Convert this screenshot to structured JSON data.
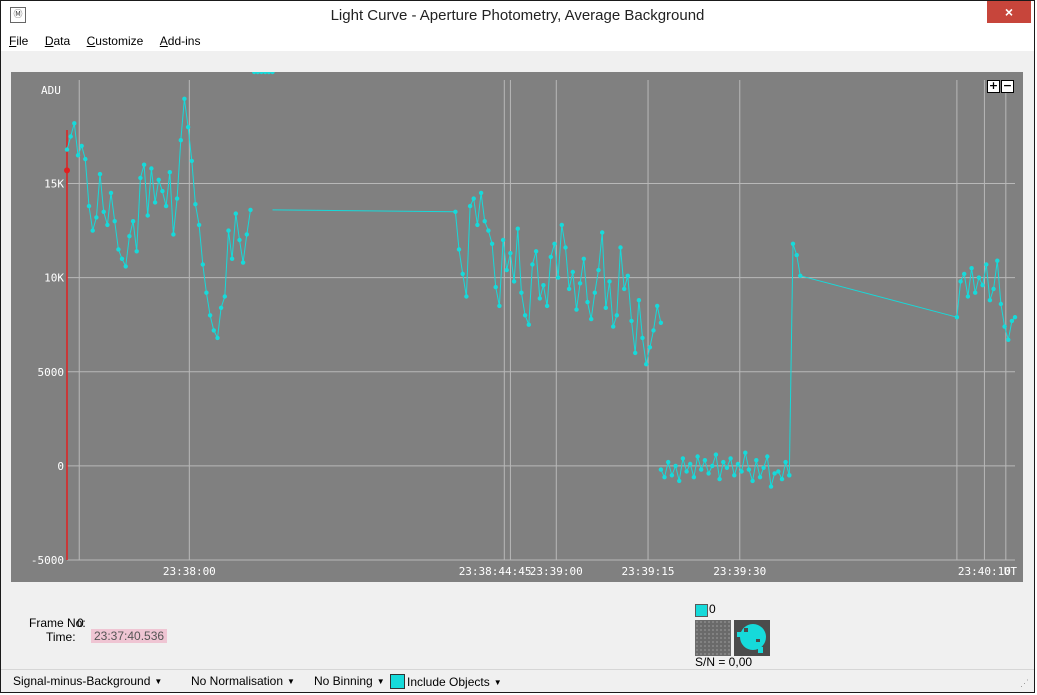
{
  "window": {
    "title": "Light Curve - Aperture Photometry, Average Background",
    "close_label": "×",
    "icon_glyph": "Ⓜ"
  },
  "menu": {
    "items": [
      {
        "label": "File",
        "hotkey": "F"
      },
      {
        "label": "Data",
        "hotkey": "D"
      },
      {
        "label": "Customize",
        "hotkey": "C"
      },
      {
        "label": "Add-ins",
        "hotkey": "A"
      }
    ]
  },
  "plot": {
    "y_unit": "ADU",
    "x_unit": "UT",
    "zoom_in": "+",
    "zoom_out": "−",
    "background": "#808080",
    "series_color": "#16dada"
  },
  "info": {
    "frame_label": "Frame No:",
    "frame_value": "0",
    "time_label": "Time:",
    "time_value": "23:37:40.536",
    "object_label": "0",
    "sn_label": "S/N =  0,00"
  },
  "status": {
    "signal": "Signal-minus-Background",
    "normalisation": "No Normalisation",
    "binning": "No Binning",
    "include": "Include Objects"
  },
  "chart_data": {
    "type": "line",
    "ylabel": "ADU",
    "xlabel": "UT",
    "ylim": [
      -5000,
      20500
    ],
    "y_ticks": [
      "15K",
      "10K",
      "5000",
      "0",
      "-5000"
    ],
    "y_tick_values": [
      15000,
      10000,
      5000,
      0,
      -5000
    ],
    "x_ticks": [
      "23:38:00",
      "23:39:00",
      "23:39:15",
      "23:39:30",
      "23:40:10"
    ],
    "x_tick_values": [
      20,
      80,
      95,
      110,
      150
    ],
    "x_overlap_label": "23:38:44:45",
    "x_range_seconds_from_23_37_40": [
      0,
      155
    ],
    "grid": true,
    "series": [
      {
        "name": "0",
        "segments": [
          {
            "x": [
              0,
              0.6,
              1.2,
              1.8,
              2.4,
              3,
              3.6,
              4.2,
              4.8,
              5.4,
              6,
              6.6,
              7.2,
              7.8,
              8.4,
              9,
              9.6,
              10.2,
              10.8,
              11.4,
              12,
              12.6,
              13.2,
              13.8,
              14.4,
              15,
              15.6,
              16.2,
              16.8,
              17.4,
              18,
              18.6,
              19.2,
              19.8,
              20.4,
              21,
              21.6,
              22.2,
              22.8,
              23.4,
              24,
              24.6,
              25.2,
              25.8,
              26.4,
              27,
              27.6,
              28.2,
              28.8,
              29.4,
              30,
              30.6,
              31.2,
              31.8,
              32.4,
              33,
              33.6
            ],
            "y": [
              16800,
              17500,
              18200,
              16500,
              17000,
              16300,
              13800,
              12500,
              13200,
              15500,
              13500,
              12800,
              14500,
              13000,
              11500,
              11000,
              10600,
              12200,
              13000,
              11400,
              15300,
              16000,
              13300,
              15800,
              14000,
              15200,
              14600,
              13800,
              15600,
              12300,
              14200,
              17300,
              19500,
              18000,
              16200,
              13900,
              12800,
              10700,
              9200,
              8000,
              7200,
              6800,
              8400,
              9000,
              12500,
              11000,
              13400,
              12000,
              10800,
              12300,
              13600
            ]
          },
          {
            "x": [
              33.6,
              63.5
            ],
            "y": [
              13600,
              13500
            ]
          },
          {
            "x": [
              63.5,
              64.1,
              64.7,
              65.3,
              65.9,
              66.5,
              67.1,
              67.7,
              68.3,
              68.9,
              69.5,
              70.1,
              70.7,
              71.3,
              71.9,
              72.5,
              73.1,
              73.7,
              74.3,
              74.9,
              75.5,
              76.1,
              76.7,
              77.3,
              77.9,
              78.5,
              79.1,
              79.7,
              80.3,
              80.9,
              81.5,
              82.1,
              82.7,
              83.3,
              83.9,
              84.5,
              85.1,
              85.7,
              86.3,
              86.9,
              87.5,
              88.1,
              88.7,
              89.3,
              89.9,
              90.5,
              91.1,
              91.7,
              92.3,
              92.9,
              93.5,
              94.1,
              94.7,
              95.3,
              95.9,
              96.5,
              97.1
            ],
            "y": [
              13500,
              11500,
              10200,
              9000,
              13800,
              14200,
              12800,
              14500,
              13000,
              12500,
              11800,
              9500,
              8500,
              12000,
              10400,
              11300,
              9800,
              12600,
              9200,
              8000,
              7500,
              10700,
              11400,
              8900,
              9600,
              8500,
              11100,
              11800,
              10000,
              12800,
              11600,
              9400,
              10300,
              8300,
              9700,
              11000,
              8700,
              7800,
              9200,
              10400,
              12400,
              8400,
              9800,
              7400,
              8000,
              11600,
              9400,
              10100,
              7700,
              6000,
              8800,
              6800,
              5400,
              6300,
              7200,
              8500,
              7600
            ]
          },
          {
            "x": [
              97.1,
              97.7,
              98.3,
              98.9,
              99.5,
              100.1,
              100.7,
              101.3,
              101.9,
              102.5,
              103.1,
              103.7,
              104.3,
              104.9,
              105.5,
              106.1,
              106.7,
              107.3,
              107.9,
              108.5,
              109.1,
              109.7,
              110.3,
              110.9,
              111.5,
              112.1,
              112.7,
              113.3,
              113.9,
              114.5,
              115.1,
              115.7,
              116.3,
              116.9,
              117.5,
              118.1
            ],
            "y": [
              -200,
              -600,
              200,
              -500,
              0,
              -800,
              400,
              -300,
              100,
              -600,
              500,
              -200,
              300,
              -400,
              0,
              600,
              -700,
              200,
              -100,
              400,
              -500,
              100,
              -300,
              700,
              -200,
              -800,
              300,
              -600,
              -100,
              500,
              -1100,
              -400,
              -300,
              -700,
              200,
              -500
            ]
          },
          {
            "x": [
              118.1,
              118.7,
              119.3,
              119.9
            ],
            "y": [
              -500,
              11800,
              11200,
              10100
            ]
          },
          {
            "x": [
              119.9,
              145.5
            ],
            "y": [
              10100,
              7900
            ]
          },
          {
            "x": [
              145.5,
              146.1,
              146.7,
              147.3,
              147.9,
              148.5,
              149.1,
              149.7,
              150.3,
              150.9,
              151.5,
              152.1,
              152.7,
              153.3,
              153.9,
              154.5,
              155
            ],
            "y": [
              7900,
              9800,
              10200,
              9000,
              10500,
              9200,
              10000,
              9600,
              10700,
              8800,
              9400,
              10900,
              8600,
              7400,
              6700,
              7700,
              7900
            ]
          }
        ]
      }
    ]
  }
}
